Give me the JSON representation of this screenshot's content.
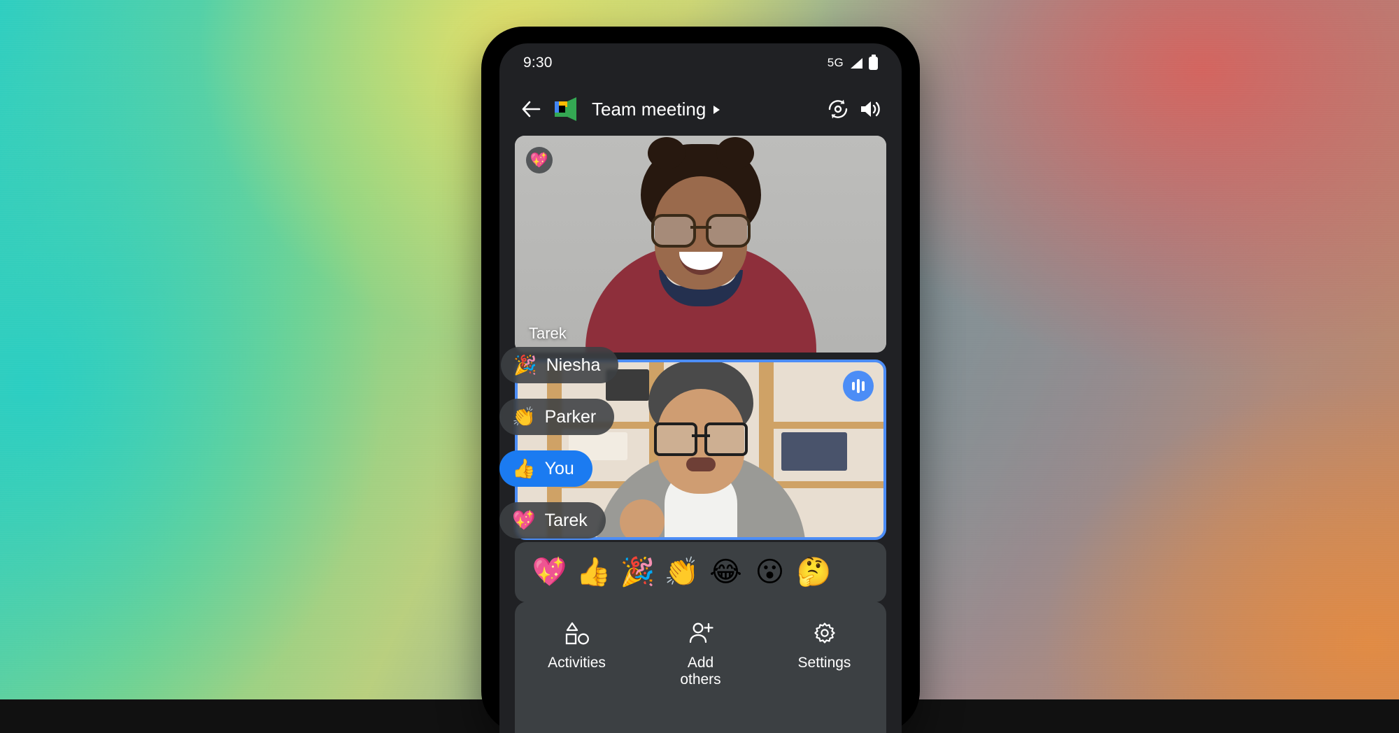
{
  "background": {
    "gradient_colors": [
      "#2ecec1",
      "#e8e068",
      "#b9cf7e",
      "#8aa0a0",
      "#d6625c",
      "#c8875d"
    ]
  },
  "phone": {
    "status_bar": {
      "time": "9:30",
      "network": "5G",
      "signal_icon": "signal-bars-icon",
      "battery_icon": "battery-icon"
    },
    "app_bar": {
      "back_icon": "back-arrow-icon",
      "logo_icon": "google-meet-logo",
      "title": "Team meeting",
      "title_caret": "▸",
      "flip_camera_icon": "flip-camera-icon",
      "speaker_icon": "speaker-volume-icon"
    },
    "tiles": [
      {
        "participant": "Tarek",
        "reaction_emoji": "💖",
        "reaction_name": "sparkling-heart",
        "active_speaker": false
      },
      {
        "participant": "",
        "reaction_emoji": "",
        "reaction_name": "",
        "active_speaker": true,
        "speaking_icon": "audio-waveform-icon"
      }
    ],
    "reaction_chips": [
      {
        "emoji": "🎉",
        "emoji_name": "party-popper",
        "name": "Niesha",
        "highlighted": false
      },
      {
        "emoji": "👏",
        "emoji_name": "clapping-hands",
        "name": "Parker",
        "highlighted": false
      },
      {
        "emoji": "👍",
        "emoji_name": "thumbs-up",
        "name": "You",
        "highlighted": true
      },
      {
        "emoji": "💖",
        "emoji_name": "sparkling-heart",
        "name": "Tarek",
        "highlighted": false
      }
    ],
    "emoji_picker": {
      "emojis": [
        "💖",
        "👍",
        "🎉",
        "👏",
        "😂",
        "😮",
        "🤔"
      ],
      "emoji_names": [
        "sparkling-heart",
        "thumbs-up",
        "party-popper",
        "clapping-hands",
        "face-with-tears-of-joy",
        "face-with-open-mouth",
        "thinking-face"
      ]
    },
    "bottom_sheet": {
      "items": [
        {
          "label": "Activities",
          "icon": "shapes-icon"
        },
        {
          "label": "Add\nothers",
          "label_line1": "Add",
          "label_line2": "others",
          "icon": "person-add-icon"
        },
        {
          "label": "Settings",
          "icon": "gear-icon"
        }
      ]
    },
    "accent_color": "#1b7bf1",
    "surface_color": "#3c4043",
    "screen_bg": "#202124"
  }
}
